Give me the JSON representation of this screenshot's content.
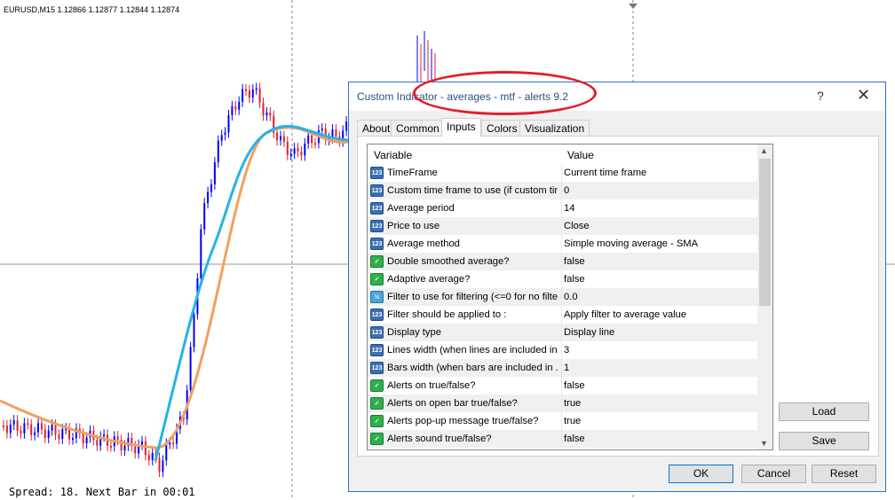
{
  "chart": {
    "symbol_info": "EURUSD,M15  1.12866 1.12877 1.12844 1.12874",
    "spread_text": "Spread: 18. Next Bar in 00:01"
  },
  "dialog": {
    "title": "Custom Indicator - averages - mtf - alerts  9.2",
    "help": "?",
    "close": "✕",
    "tabs": [
      "About",
      "Common",
      "Inputs",
      "Colors",
      "Visualization"
    ],
    "active_tab": "Inputs",
    "grid": {
      "col_variable": "Variable",
      "col_value": "Value",
      "rows": [
        {
          "icon": "int",
          "icon_text": "123",
          "name": "TimeFrame",
          "value": "Current time frame"
        },
        {
          "icon": "int",
          "icon_text": "123",
          "name": "Custom time frame to use (if custom tim...",
          "value": "0"
        },
        {
          "icon": "int",
          "icon_text": "123",
          "name": "Average period",
          "value": "14"
        },
        {
          "icon": "int",
          "icon_text": "123",
          "name": "Price to use",
          "value": "Close"
        },
        {
          "icon": "int",
          "icon_text": "123",
          "name": "Average method",
          "value": "Simple moving average - SMA"
        },
        {
          "icon": "bool",
          "icon_text": "✓",
          "name": "Double smoothed average?",
          "value": "false"
        },
        {
          "icon": "bool",
          "icon_text": "✓",
          "name": "Adaptive average?",
          "value": "false"
        },
        {
          "icon": "dbl",
          "icon_text": "½",
          "name": "Filter to use for filtering (<=0 for no filteri...",
          "value": "0.0"
        },
        {
          "icon": "int",
          "icon_text": "123",
          "name": "Filter should be applied to :",
          "value": "Apply filter to average value"
        },
        {
          "icon": "int",
          "icon_text": "123",
          "name": "Display type",
          "value": "Display line"
        },
        {
          "icon": "int",
          "icon_text": "123",
          "name": "Lines width (when lines are included in ...",
          "value": "3"
        },
        {
          "icon": "int",
          "icon_text": "123",
          "name": "Bars width (when bars are included in ...",
          "value": "1"
        },
        {
          "icon": "bool",
          "icon_text": "✓",
          "name": "Alerts on true/false?",
          "value": "false"
        },
        {
          "icon": "bool",
          "icon_text": "✓",
          "name": "Alerts on open bar true/false?",
          "value": "true"
        },
        {
          "icon": "bool",
          "icon_text": "✓",
          "name": "Alerts pop-up message true/false?",
          "value": "true"
        },
        {
          "icon": "bool",
          "icon_text": "✓",
          "name": "Alerts sound true/false?",
          "value": "false"
        }
      ]
    },
    "buttons": {
      "load": "Load",
      "save": "Save",
      "ok": "OK",
      "cancel": "Cancel",
      "reset": "Reset"
    }
  },
  "colors": {
    "bull_candle": "#0000ff",
    "bear_candle": "#e0202a",
    "average_line": "#27b2e8",
    "slow_average": "#f0a060",
    "highlight": "#e0202a",
    "title_text": "#2b4e7d"
  }
}
